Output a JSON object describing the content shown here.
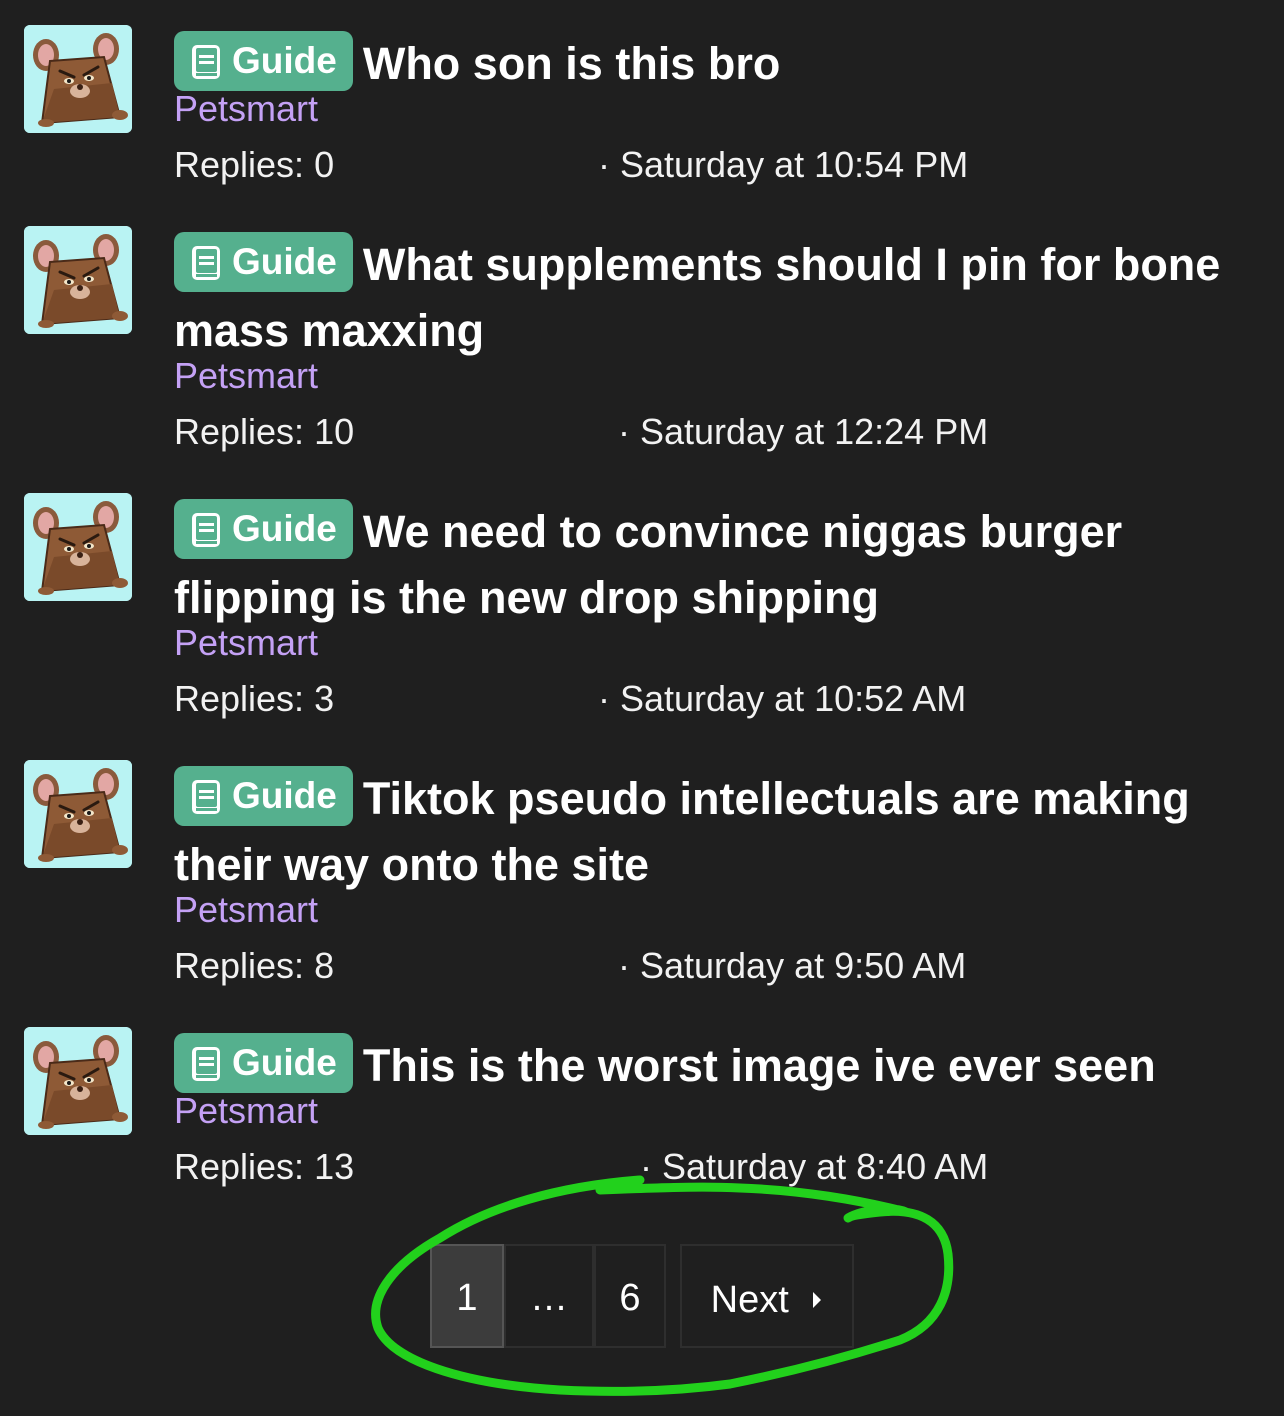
{
  "threads": [
    {
      "badge": "Guide",
      "title": "Who son is this bro",
      "forum": "Petsmart",
      "replies": "Replies: 0",
      "date": "· Saturday at 10:54 PM"
    },
    {
      "badge": "Guide",
      "title": "What supplements should I pin for bone mass maxxing",
      "forum": "Petsmart",
      "replies": "Replies: 10",
      "date": "· Saturday at 12:24 PM"
    },
    {
      "badge": "Guide",
      "title": "We need to convince niggas burger flipping is the new drop shipping",
      "forum": "Petsmart",
      "replies": "Replies: 3",
      "date": "· Saturday at 10:52 AM"
    },
    {
      "badge": "Guide",
      "title": "Tiktok pseudo intellectuals are making their way onto the site",
      "forum": "Petsmart",
      "replies": "Replies: 8",
      "date": "· Saturday at 9:50 AM"
    },
    {
      "badge": "Guide",
      "title": "This is the worst image ive ever seen",
      "forum": "Petsmart",
      "replies": "Replies: 13",
      "date": "· Saturday at 8:40 AM"
    }
  ],
  "pagination": {
    "current": "1",
    "ellipsis": "…",
    "last": "6",
    "next": "Next"
  },
  "colors": {
    "background": "#1f1f1f",
    "badge": "#55b08e",
    "forum_link": "#c4a1f5",
    "avatar_bg": "#b9f3f3",
    "annotation": "#22d11c"
  },
  "icons": [
    "avatar-mouse-icon",
    "guide-book-icon",
    "next-caret-icon"
  ]
}
